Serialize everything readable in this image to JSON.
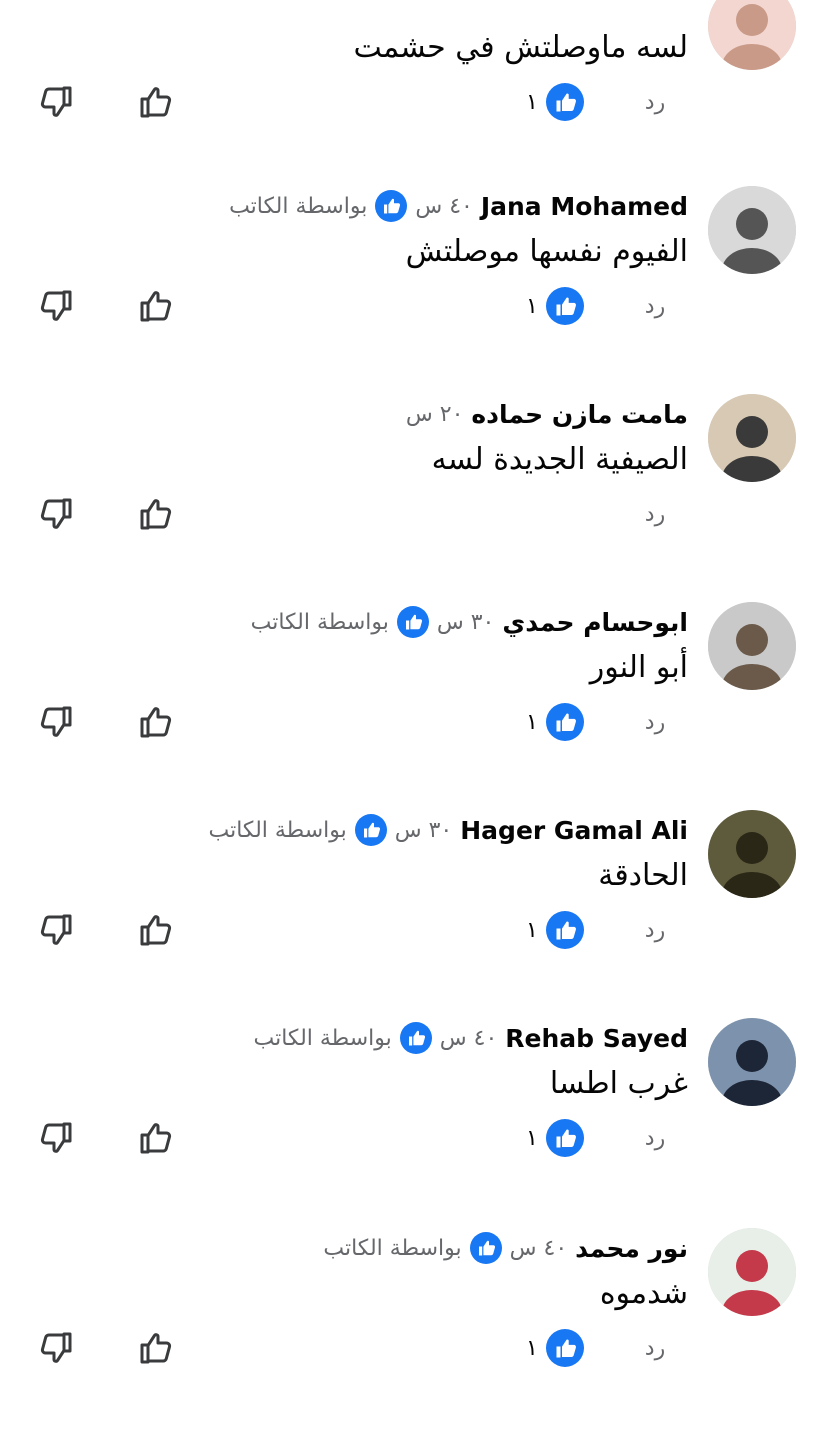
{
  "comments": [
    {
      "name": "",
      "time": "",
      "author_label": "",
      "text": "لسه ماوصلتش في حشمت",
      "reply_label": "رد",
      "likes": "١",
      "avatar_colors": [
        "#f2d6cf",
        "#c99a88"
      ]
    },
    {
      "name": "Jana Mohamed",
      "time": "٤٠ س",
      "author_label": "بواسطة الكاتب",
      "text": "الفيوم نفسها موصلتش",
      "reply_label": "رد",
      "likes": "١",
      "avatar_colors": [
        "#d9d9d9",
        "#555555"
      ]
    },
    {
      "name": "مامت مازن حماده",
      "time": "٢٠ س",
      "author_label": "",
      "text": "الصيفية الجديدة لسه",
      "reply_label": "رد",
      "likes": "",
      "avatar_colors": [
        "#d8c9b4",
        "#3a3a3a"
      ]
    },
    {
      "name": "ابوحسام حمدي",
      "time": "٣٠ س",
      "author_label": "بواسطة الكاتب",
      "text": "أبو النور",
      "reply_label": "رد",
      "likes": "١",
      "avatar_colors": [
        "#c9c9c9",
        "#6b5a4a"
      ]
    },
    {
      "name": "Hager Gamal Ali",
      "time": "٣٠ س",
      "author_label": "بواسطة الكاتب",
      "text": "الحادقة",
      "reply_label": "رد",
      "likes": "١",
      "avatar_colors": [
        "#5e5a3c",
        "#2a2716"
      ]
    },
    {
      "name": "Rehab Sayed",
      "time": "٤٠ س",
      "author_label": "بواسطة الكاتب",
      "text": "غرب اطسا",
      "reply_label": "رد",
      "likes": "١",
      "avatar_colors": [
        "#7d93ad",
        "#1d2636"
      ]
    },
    {
      "name": "نور محمد",
      "time": "٤٠ س",
      "author_label": "بواسطة الكاتب",
      "text": "شدموه",
      "reply_label": "رد",
      "likes": "١",
      "avatar_colors": [
        "#e8efe9",
        "#c43a4a"
      ]
    }
  ],
  "colors": {
    "like_blue": "#1877f2",
    "secondary_text": "#65676b",
    "primary_text": "#050505",
    "icon_stroke": "#3a3b3c"
  },
  "icons": {
    "author": "author-badge-icon",
    "like_badge": "like-reaction-icon",
    "like": "thumb-up-icon",
    "dislike": "thumb-down-icon"
  }
}
